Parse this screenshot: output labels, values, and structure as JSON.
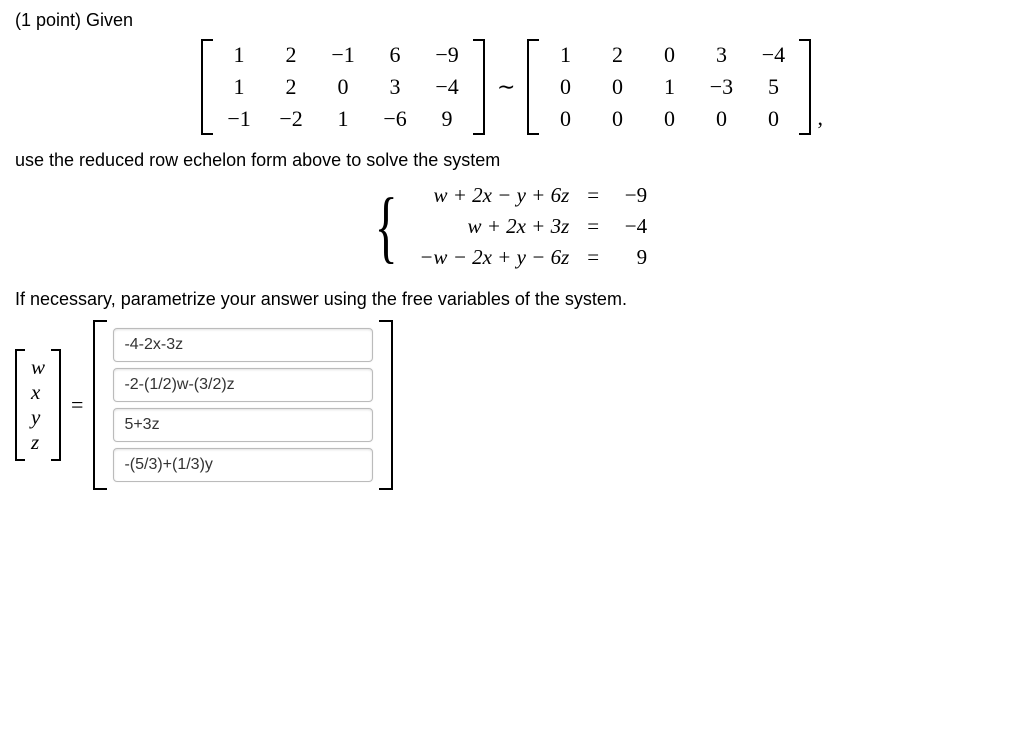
{
  "header": "(1 point) Given",
  "matrixA": [
    [
      "1",
      "2",
      "−1",
      "6",
      "−9"
    ],
    [
      "1",
      "2",
      "0",
      "3",
      "−4"
    ],
    [
      "−1",
      "−2",
      "1",
      "−6",
      "9"
    ]
  ],
  "tilde": "∼",
  "matrixB": [
    [
      "1",
      "2",
      "0",
      "3",
      "−4"
    ],
    [
      "0",
      "0",
      "1",
      "−3",
      "5"
    ],
    [
      "0",
      "0",
      "0",
      "0",
      "0"
    ]
  ],
  "trailingComma": ",",
  "instr1": "use the reduced row echelon form above to solve the system",
  "system": {
    "e1": {
      "lhs": "w + 2x − y + 6z",
      "eq": "=",
      "rhs": "−9"
    },
    "e2": {
      "lhs": "w + 2x + 3z",
      "eq": "=",
      "rhs": "−4"
    },
    "e3": {
      "lhs": "−w − 2x + y − 6z",
      "eq": "=",
      "rhs": "9"
    }
  },
  "instr2": "If necessary, parametrize your answer using the free variables of the system.",
  "varLabels": [
    "w",
    "x",
    "y",
    "z"
  ],
  "equals": "=",
  "answers": {
    "w": "-4-2x-3z",
    "x": "-2-(1/2)w-(3/2)z",
    "y": "5+3z",
    "z": "-(5/3)+(1/3)y"
  }
}
